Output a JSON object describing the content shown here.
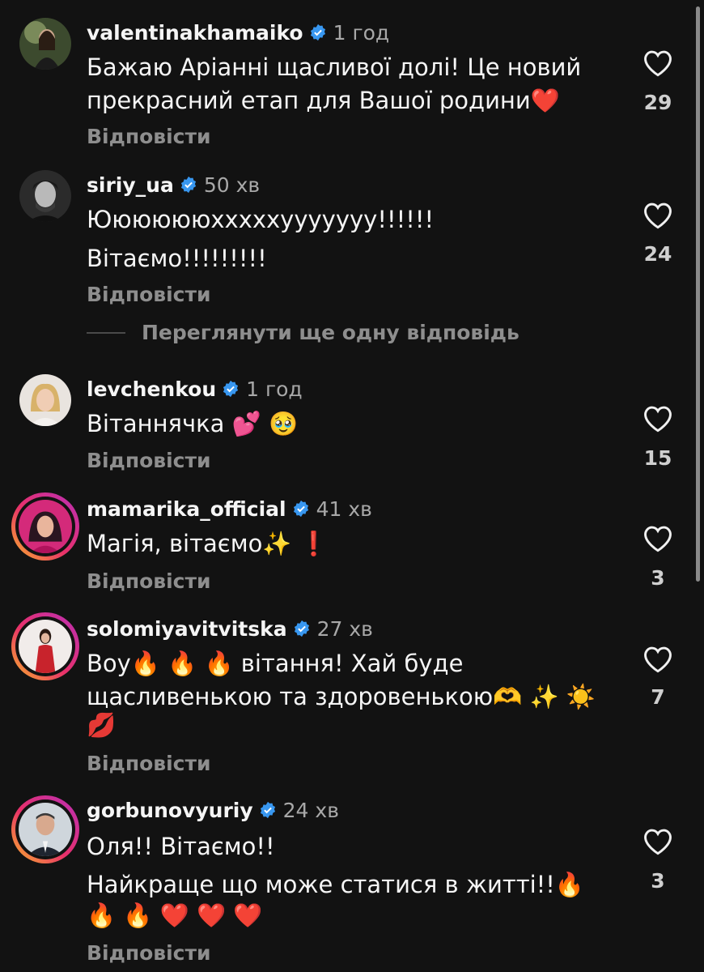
{
  "reply_label": "Відповісти",
  "view_more_label": "Переглянути ще одну відповідь",
  "colors": {
    "background": "#121212",
    "verified": "#3897f0",
    "muted": "#8e8e8e"
  },
  "comments": [
    {
      "username": "valentinakhamaiko",
      "time": "1 год",
      "lines": [
        "Бажаю Аріанні щасливої долі!  Це новий",
        "прекрасний етап для Вашої родини❤️"
      ],
      "likes": "29"
    },
    {
      "username": "siriy_ua",
      "time": "50 хв",
      "lines": [
        "Ююююююхххххууууууу!!!!!!",
        "Вітаємо!!!!!!!!!"
      ],
      "likes": "24"
    },
    {
      "username": "levchenkou",
      "time": "1 год",
      "lines": [
        "Вітаннячка 💕 🥹"
      ],
      "likes": "15"
    },
    {
      "username": "mamarika_official",
      "time": "41 хв",
      "lines": [
        "Магія, вітаємо✨ ❗"
      ],
      "likes": "3"
    },
    {
      "username": "solomiyavitvitska",
      "time": "27 хв",
      "lines": [
        "Воу🔥 🔥 🔥  вітання! Хай буде",
        "щасливенькою та здоровенькою🫶 ✨ ☀️",
        "💋"
      ],
      "likes": "7"
    },
    {
      "username": "gorbunovyuriy",
      "time": "24 хв",
      "lines": [
        "Оля!! Вітаємо!!",
        "Найкраще що може статися в житті!!🔥",
        "🔥 🔥 ❤️ ❤️ ❤️"
      ],
      "likes": "3"
    }
  ]
}
